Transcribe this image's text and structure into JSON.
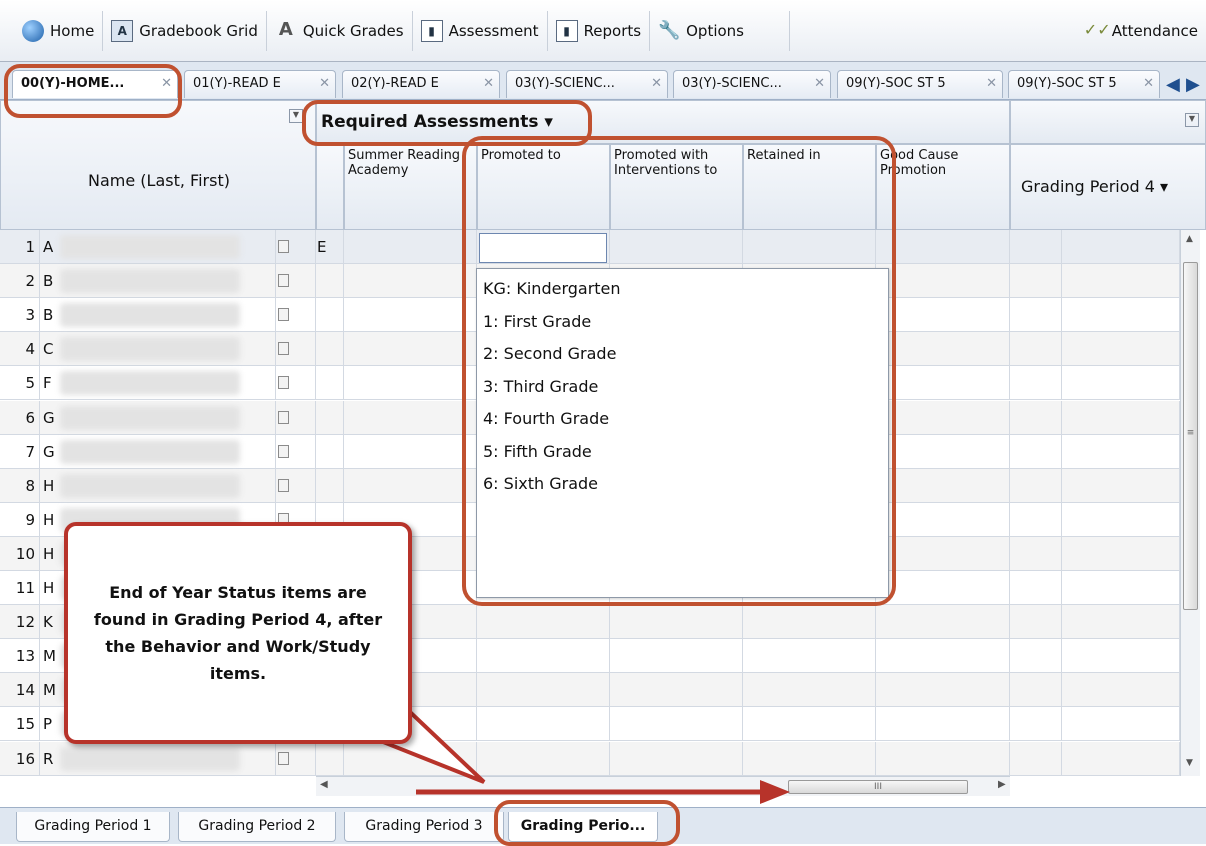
{
  "toolbar": {
    "home": "Home",
    "gradebook_grid": "Gradebook Grid",
    "quick_grades": "Quick Grades",
    "assessment": "Assessment",
    "reports": "Reports",
    "options": "Options",
    "attendance": "Attendance"
  },
  "class_tabs": [
    "00(Y)-HOME...",
    "01(Y)-READ E",
    "02(Y)-READ E",
    "03(Y)-SCIENC...",
    "03(Y)-SCIENC...",
    "09(Y)-SOC ST 5",
    "09(Y)-SOC ST 5"
  ],
  "grid": {
    "name_header": "Name (Last, First)",
    "group_header": "Required Assessments ▾",
    "columns": [
      "Summer Reading Academy",
      "Promoted to",
      "Promoted with Interventions to",
      "Retained in",
      "Good Cause Promotion"
    ],
    "right_header": "Grading Period 4 ▾",
    "rows": [
      {
        "n": "1",
        "initial": "A"
      },
      {
        "n": "2",
        "initial": "B"
      },
      {
        "n": "3",
        "initial": "B"
      },
      {
        "n": "4",
        "initial": "C"
      },
      {
        "n": "5",
        "initial": "F"
      },
      {
        "n": "6",
        "initial": "G"
      },
      {
        "n": "7",
        "initial": "G"
      },
      {
        "n": "8",
        "initial": "H"
      },
      {
        "n": "9",
        "initial": "H"
      },
      {
        "n": "10",
        "initial": "H"
      },
      {
        "n": "11",
        "initial": "H"
      },
      {
        "n": "12",
        "initial": "K"
      },
      {
        "n": "13",
        "initial": "M"
      },
      {
        "n": "14",
        "initial": "M"
      },
      {
        "n": "15",
        "initial": "P"
      },
      {
        "n": "16",
        "initial": "R"
      }
    ],
    "row1_extra": "E"
  },
  "dropdown_options": [
    "KG: Kindergarten",
    "1: First Grade",
    "2: Second Grade",
    "3: Third Grade",
    "4: Fourth Grade",
    "5: Fifth Grade",
    "6: Sixth Grade"
  ],
  "callout": "End of Year Status items are found in Grading Period 4, after the Behavior and Work/Study items.",
  "bottom_tabs": [
    "Grading Period 1",
    "Grading Period 2",
    "Grading Period 3",
    "Grading Perio..."
  ],
  "colors": {
    "annotation": "#c05130",
    "callout_border": "#b7332a"
  }
}
